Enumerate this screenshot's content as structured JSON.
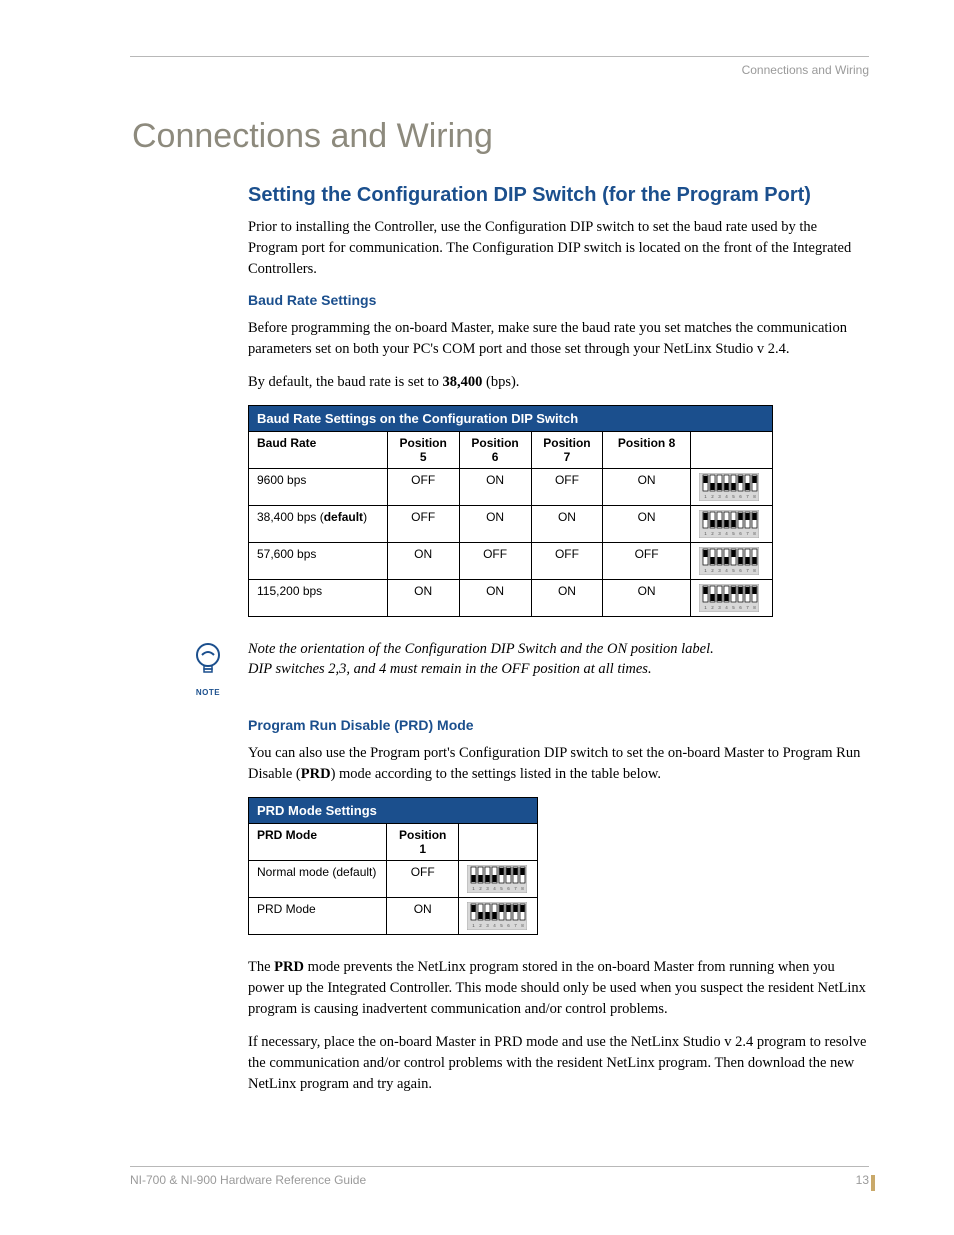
{
  "header": {
    "section": "Connections and Wiring"
  },
  "h1": "Connections and Wiring",
  "h2": "Setting the Configuration DIP Switch (for the Program Port)",
  "intro": "Prior to installing the Controller, use the Configuration DIP switch to set the baud rate used by the Program port for communication. The Configuration DIP switch is located on the front of the Integrated Controllers.",
  "h3_baud": "Baud Rate Settings",
  "baud_p1": "Before programming the on-board Master, make sure the baud rate you set matches the communication parameters set on both your PC's COM port and those set through your NetLinx Studio v 2.4.",
  "baud_p2_pre": "By default, the baud rate is set to ",
  "baud_p2_bold": "38,400",
  "baud_p2_post": " (bps).",
  "table1": {
    "title": "Baud Rate Settings on the Configuration DIP Switch",
    "headers": [
      "Baud Rate",
      "Position 5",
      "Position 6",
      "Position 7",
      "Position 8",
      ""
    ],
    "rows": [
      {
        "label_pre": "9600 bps",
        "label_bold": "",
        "label_post": "",
        "p5": "OFF",
        "p6": "ON",
        "p7": "OFF",
        "p8": "ON",
        "dip": [
          1,
          0,
          0,
          0,
          0,
          1,
          0,
          1
        ]
      },
      {
        "label_pre": "38,400 bps (",
        "label_bold": "default",
        "label_post": ")",
        "p5": "OFF",
        "p6": "ON",
        "p7": "ON",
        "p8": "ON",
        "dip": [
          1,
          0,
          0,
          0,
          0,
          1,
          1,
          1
        ]
      },
      {
        "label_pre": "57,600 bps",
        "label_bold": "",
        "label_post": "",
        "p5": "ON",
        "p6": "OFF",
        "p7": "OFF",
        "p8": "OFF",
        "dip": [
          1,
          0,
          0,
          0,
          1,
          0,
          0,
          0
        ]
      },
      {
        "label_pre": "115,200 bps",
        "label_bold": "",
        "label_post": "",
        "p5": "ON",
        "p6": "ON",
        "p7": "ON",
        "p8": "ON",
        "dip": [
          1,
          0,
          0,
          0,
          1,
          1,
          1,
          1
        ]
      }
    ]
  },
  "note": {
    "label": "NOTE",
    "line1": "Note the orientation of the Configuration DIP Switch and the ON position label.",
    "line2": "DIP switches 2,3, and 4 must remain in the OFF position at all times."
  },
  "h3_prd": "Program Run Disable (PRD) Mode",
  "prd_p1_pre": "You can also use the Program port's Configuration DIP switch to set the on-board Master to Program Run Disable (",
  "prd_p1_bold": "PRD",
  "prd_p1_post": ") mode according to the settings listed in the table below.",
  "table2": {
    "title": "PRD Mode Settings",
    "headers": [
      "PRD Mode",
      "Position 1",
      ""
    ],
    "rows": [
      {
        "label": "Normal mode (default)",
        "p1": "OFF",
        "dip": [
          0,
          0,
          0,
          0,
          1,
          1,
          1,
          1
        ]
      },
      {
        "label": "PRD Mode",
        "p1": "ON",
        "dip": [
          1,
          0,
          0,
          0,
          1,
          1,
          1,
          1
        ]
      }
    ]
  },
  "prd_p2_pre": "The ",
  "prd_p2_bold": "PRD",
  "prd_p2_post": " mode prevents the NetLinx program stored in the on-board Master from running when you power up the Integrated Controller. This mode should only be used when you suspect the resident NetLinx program is causing inadvertent communication and/or control problems.",
  "prd_p3": "If necessary, place the on-board Master in PRD mode and use the NetLinx Studio v 2.4 program to resolve the communication and/or control problems with the resident NetLinx program. Then download the new NetLinx program and try again.",
  "footer": {
    "left": "NI-700 & NI-900 Hardware Reference Guide",
    "right": "13"
  },
  "chart_data": [
    {
      "type": "table",
      "title": "Baud Rate Settings on the Configuration DIP Switch",
      "columns": [
        "Baud Rate",
        "Position 5",
        "Position 6",
        "Position 7",
        "Position 8"
      ],
      "rows": [
        [
          "9600 bps",
          "OFF",
          "ON",
          "OFF",
          "ON"
        ],
        [
          "38,400 bps (default)",
          "OFF",
          "ON",
          "ON",
          "ON"
        ],
        [
          "57,600 bps",
          "ON",
          "OFF",
          "OFF",
          "OFF"
        ],
        [
          "115,200 bps",
          "ON",
          "ON",
          "ON",
          "ON"
        ]
      ]
    },
    {
      "type": "table",
      "title": "PRD Mode Settings",
      "columns": [
        "PRD Mode",
        "Position 1"
      ],
      "rows": [
        [
          "Normal mode (default)",
          "OFF"
        ],
        [
          "PRD Mode",
          "ON"
        ]
      ]
    }
  ]
}
